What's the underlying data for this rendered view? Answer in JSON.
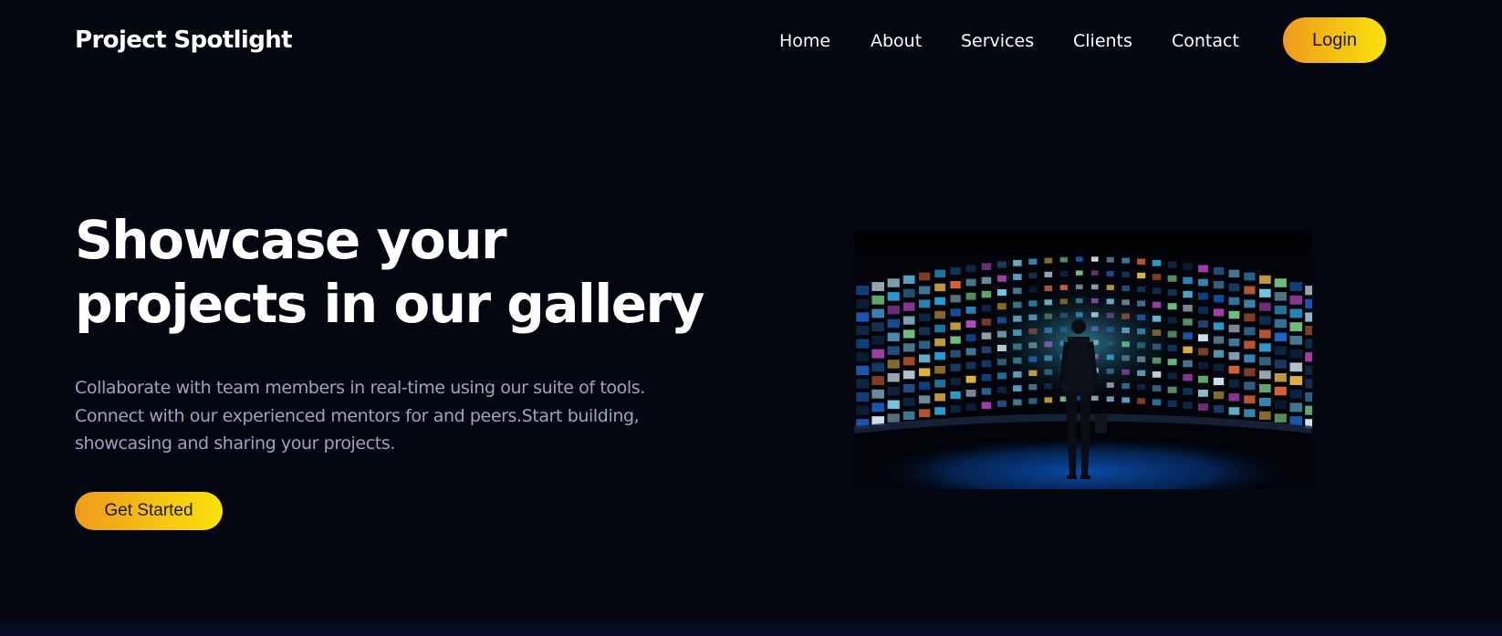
{
  "header": {
    "brand": "Project Spotlight",
    "nav": [
      {
        "label": "Home"
      },
      {
        "label": "About"
      },
      {
        "label": "Services"
      },
      {
        "label": "Clients"
      },
      {
        "label": "Contact"
      }
    ],
    "login_label": "Login"
  },
  "hero": {
    "title_line1": "Showcase your",
    "title_line2": "projects in our gallery",
    "description_line1": "Collaborate with team members in real-time using our suite of tools.",
    "description_line2": "Connect with our experienced mentors for and peers.Start building,",
    "description_line3": "showcasing and sharing your projects.",
    "cta_label": "Get Started"
  },
  "colors": {
    "background": "#03050f",
    "accent_start": "#f09a1c",
    "accent_end": "#f8e30c",
    "body_text": "#9aa6bf"
  }
}
